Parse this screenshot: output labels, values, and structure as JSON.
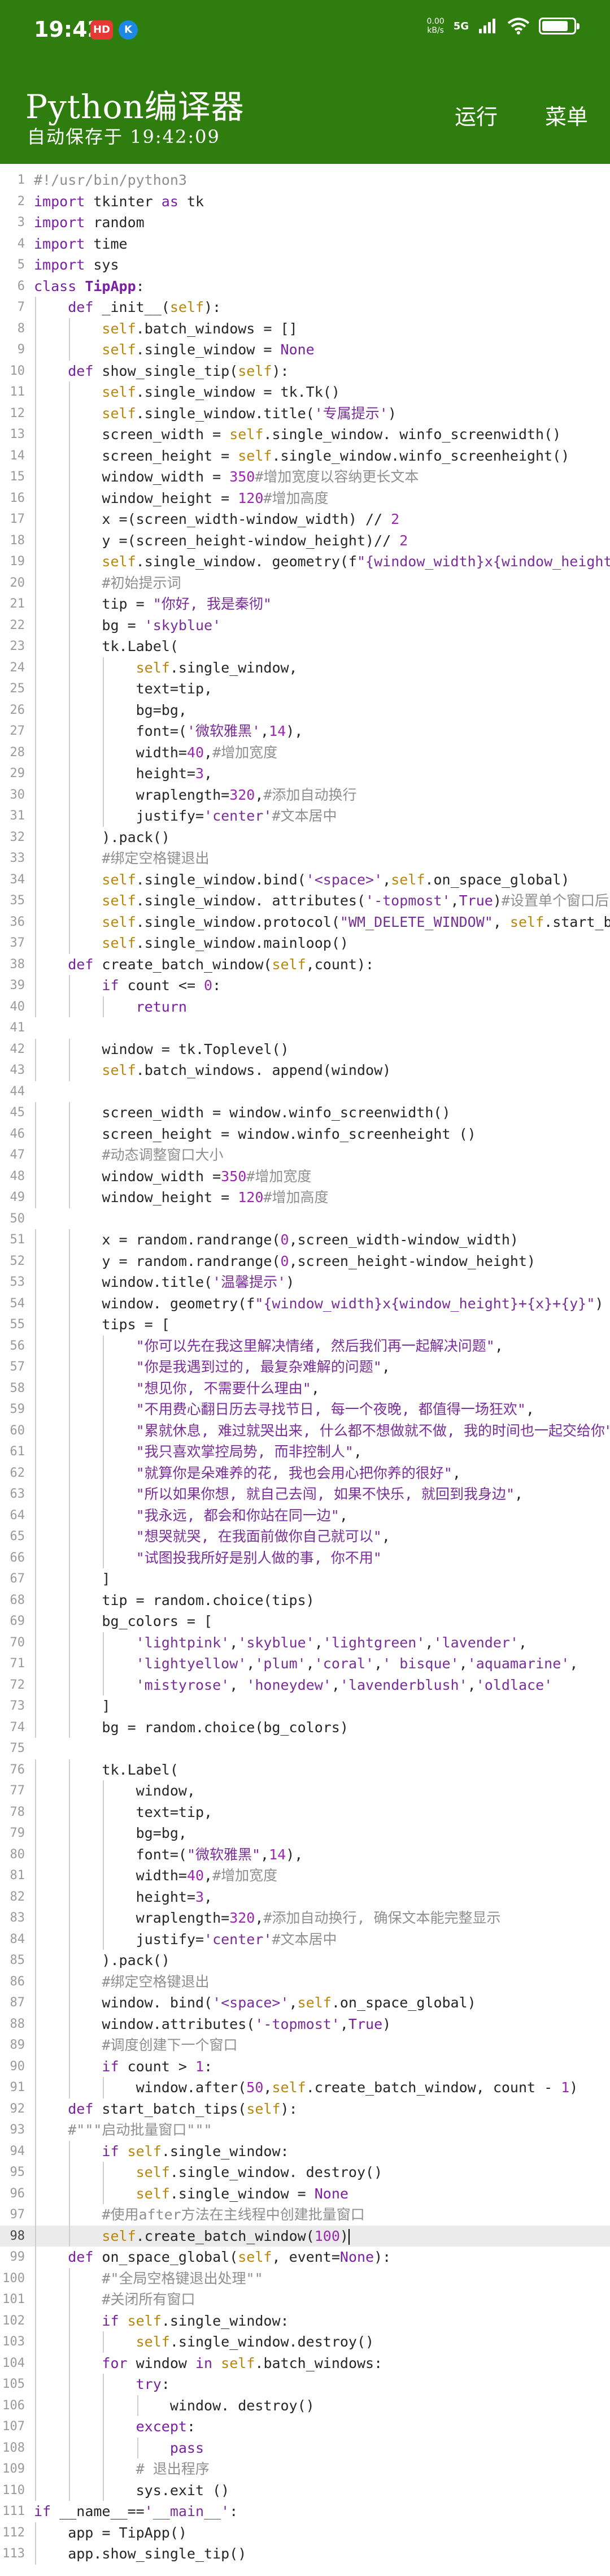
{
  "status_bar": {
    "time": "19:42",
    "badge_hd": "HD",
    "badge_k": "K",
    "net_speed_value": "0.00",
    "net_speed_unit": "kB/s",
    "net_type": "5G",
    "battery_level": 0.85
  },
  "header": {
    "title": "Python编译器",
    "autosave": "自动保存于 19:42:09",
    "run_label": "运行",
    "menu_label": "菜单"
  },
  "editor": {
    "current_line": 98,
    "lines": [
      {
        "n": "1",
        "text": "#!/usr/bin/python3"
      },
      {
        "n": "2",
        "text": "import tkinter as tk"
      },
      {
        "n": "3",
        "text": "import random"
      },
      {
        "n": "4",
        "text": "import time"
      },
      {
        "n": "5",
        "text": "import sys"
      },
      {
        "n": "6",
        "text": "class TipApp:"
      },
      {
        "n": "7",
        "text": "    def _init__(self):"
      },
      {
        "n": "8",
        "text": "        self.batch_windows = []"
      },
      {
        "n": "9",
        "text": "        self.single_window = None"
      },
      {
        "n": "10",
        "text": "    def show_single_tip(self):"
      },
      {
        "n": "11",
        "text": "        self.single_window = tk.Tk()"
      },
      {
        "n": "12",
        "text": "        self.single_window.title('专属提示')"
      },
      {
        "n": "13",
        "text": "        screen_width = self.single_window. winfo_screenwidth()"
      },
      {
        "n": "14",
        "text": "        screen_height = self.single_window.winfo_screenheight()"
      },
      {
        "n": "15",
        "text": "        window_width = 350#增加宽度以容纳更长文本"
      },
      {
        "n": "16",
        "text": "        window_height = 120#增加高度"
      },
      {
        "n": "17",
        "text": "        x =(screen_width-window_width) // 2"
      },
      {
        "n": "18",
        "text": "        y =(screen_height-window_height)// 2"
      },
      {
        "n": "19",
        "text": "        self.single_window. geometry(f\"{window_width}x{window_height}+{x}+{y}\")"
      },
      {
        "n": "20",
        "text": "        #初始提示词"
      },
      {
        "n": "21",
        "text": "        tip = \"你好, 我是秦彻\""
      },
      {
        "n": "22",
        "text": "        bg = 'skyblue'"
      },
      {
        "n": "23",
        "text": "        tk.Label("
      },
      {
        "n": "24",
        "text": "            self.single_window,"
      },
      {
        "n": "25",
        "text": "            text=tip,"
      },
      {
        "n": "26",
        "text": "            bg=bg,"
      },
      {
        "n": "27",
        "text": "            font=('微软雅黑',14),"
      },
      {
        "n": "28",
        "text": "            width=40,#增加宽度"
      },
      {
        "n": "29",
        "text": "            height=3,"
      },
      {
        "n": "30",
        "text": "            wraplength=320,#添加自动换行"
      },
      {
        "n": "31",
        "text": "            justify='center'#文本居中"
      },
      {
        "n": "32",
        "text": "        ).pack()"
      },
      {
        "n": "33",
        "text": "        #绑定空格键退出"
      },
      {
        "n": "34",
        "text": "        self.single_window.bind('<space>',self.on_space_global)"
      },
      {
        "n": "35",
        "text": "        self.single_window. attributes('-topmost',True)#设置单个窗口后"
      },
      {
        "n": "36",
        "text": "        self.single_window.protocol(\"WM_DELETE_WINDOW\", self.start_batch_tips)"
      },
      {
        "n": "37",
        "text": "        self.single_window.mainloop()"
      },
      {
        "n": "38",
        "text": "    def create_batch_window(self,count):"
      },
      {
        "n": "39",
        "text": "        if count <= 0:"
      },
      {
        "n": "40",
        "text": "            return"
      },
      {
        "n": "41",
        "text": ""
      },
      {
        "n": "42",
        "text": "        window = tk.Toplevel()"
      },
      {
        "n": "43",
        "text": "        self.batch_windows. append(window)"
      },
      {
        "n": "44",
        "text": ""
      },
      {
        "n": "45",
        "text": "        screen_width = window.winfo_screenwidth()"
      },
      {
        "n": "46",
        "text": "        screen_height = window.winfo_screenheight ()"
      },
      {
        "n": "47",
        "text": "        #动态调整窗口大小"
      },
      {
        "n": "48",
        "text": "        window_width =350#增加宽度"
      },
      {
        "n": "49",
        "text": "        window_height = 120#增加高度"
      },
      {
        "n": "50",
        "text": ""
      },
      {
        "n": "51",
        "text": "        x = random.randrange(0,screen_width-window_width)"
      },
      {
        "n": "52",
        "text": "        y = random.randrange(0,screen_height-window_height)"
      },
      {
        "n": "53",
        "text": "        window.title('温馨提示')"
      },
      {
        "n": "54",
        "text": "        window. geometry(f\"{window_width}x{window_height}+{x}+{y}\")"
      },
      {
        "n": "55",
        "text": "        tips = ["
      },
      {
        "n": "56",
        "text": "            \"你可以先在我这里解决情绪, 然后我们再一起解决问题\","
      },
      {
        "n": "57",
        "text": "            \"你是我遇到过的, 最复杂难解的问题\","
      },
      {
        "n": "58",
        "text": "            \"想见你, 不需要什么理由\","
      },
      {
        "n": "59",
        "text": "            \"不用费心翻日历去寻找节日, 每一个夜晚, 都值得一场狂欢\","
      },
      {
        "n": "60",
        "text": "            \"累就休息, 难过就哭出来, 什么都不想做就不做, 我的时间也一起交给你\","
      },
      {
        "n": "61",
        "text": "            \"我只喜欢掌控局势, 而非控制人\","
      },
      {
        "n": "62",
        "text": "            \"就算你是朵难养的花, 我也会用心把你养的很好\","
      },
      {
        "n": "63",
        "text": "            \"所以如果你想, 就自己去闯, 如果不快乐, 就回到我身边\","
      },
      {
        "n": "64",
        "text": "            \"我永远, 都会和你站在同一边\","
      },
      {
        "n": "65",
        "text": "            \"想哭就哭, 在我面前做你自己就可以\","
      },
      {
        "n": "66",
        "text": "            \"试图投我所好是别人做的事, 你不用\""
      },
      {
        "n": "67",
        "text": "        ]"
      },
      {
        "n": "68",
        "text": "        tip = random.choice(tips)"
      },
      {
        "n": "69",
        "text": "        bg_colors = ["
      },
      {
        "n": "70",
        "text": "            'lightpink','skyblue','lightgreen','lavender',"
      },
      {
        "n": "71",
        "text": "            'lightyellow','plum','coral',' bisque','aquamarine',"
      },
      {
        "n": "72",
        "text": "            'mistyrose', 'honeydew','lavenderblush','oldlace'"
      },
      {
        "n": "73",
        "text": "        ]"
      },
      {
        "n": "74",
        "text": "        bg = random.choice(bg_colors)"
      },
      {
        "n": "75",
        "text": ""
      },
      {
        "n": "76",
        "text": "        tk.Label("
      },
      {
        "n": "77",
        "text": "            window,"
      },
      {
        "n": "78",
        "text": "            text=tip,"
      },
      {
        "n": "79",
        "text": "            bg=bg,"
      },
      {
        "n": "80",
        "text": "            font=(\"微软雅黑\",14),"
      },
      {
        "n": "81",
        "text": "            width=40,#增加宽度"
      },
      {
        "n": "82",
        "text": "            height=3,"
      },
      {
        "n": "83",
        "text": "            wraplength=320,#添加自动换行, 确保文本能完整显示"
      },
      {
        "n": "84",
        "text": "            justify='center'#文本居中"
      },
      {
        "n": "85",
        "text": "        ).pack()"
      },
      {
        "n": "86",
        "text": "        #绑定空格键退出"
      },
      {
        "n": "87",
        "text": "        window. bind('<space>',self.on_space_global)"
      },
      {
        "n": "88",
        "text": "        window.attributes('-topmost',True)"
      },
      {
        "n": "89",
        "text": "        #调度创建下一个窗口"
      },
      {
        "n": "90",
        "text": "        if count > 1:"
      },
      {
        "n": "91",
        "text": "            window.after(50,self.create_batch_window, count - 1)"
      },
      {
        "n": "92",
        "text": "    def start_batch_tips(self):"
      },
      {
        "n": "93",
        "text": "    #\"\"\"启动批量窗口\"\"\""
      },
      {
        "n": "94",
        "text": "        if self.single_window:"
      },
      {
        "n": "95",
        "text": "            self.single_window. destroy()"
      },
      {
        "n": "96",
        "text": "            self.single_window = None"
      },
      {
        "n": "97",
        "text": "        #使用after方法在主线程中创建批量窗口"
      },
      {
        "n": "98",
        "text": "        self.create_batch_window(100)"
      },
      {
        "n": "99",
        "text": "    def on_space_global(self, event=None):"
      },
      {
        "n": "100",
        "text": "        #\"全局空格键退出处理\"\""
      },
      {
        "n": "101",
        "text": "        #关闭所有窗口"
      },
      {
        "n": "102",
        "text": "        if self.single_window:"
      },
      {
        "n": "103",
        "text": "            self.single_window.destroy()"
      },
      {
        "n": "104",
        "text": "        for window in self.batch_windows:"
      },
      {
        "n": "105",
        "text": "            try:"
      },
      {
        "n": "106",
        "text": "                window. destroy()"
      },
      {
        "n": "107",
        "text": "            except:"
      },
      {
        "n": "108",
        "text": "                pass"
      },
      {
        "n": "109",
        "text": "            # 退出程序"
      },
      {
        "n": "110",
        "text": "            sys.exit ()"
      },
      {
        "n": "111",
        "text": "if __name__=='__main__':"
      },
      {
        "n": "112",
        "text": "    app = TipApp()"
      },
      {
        "n": "113",
        "text": "    app.show_single_tip()"
      }
    ]
  }
}
